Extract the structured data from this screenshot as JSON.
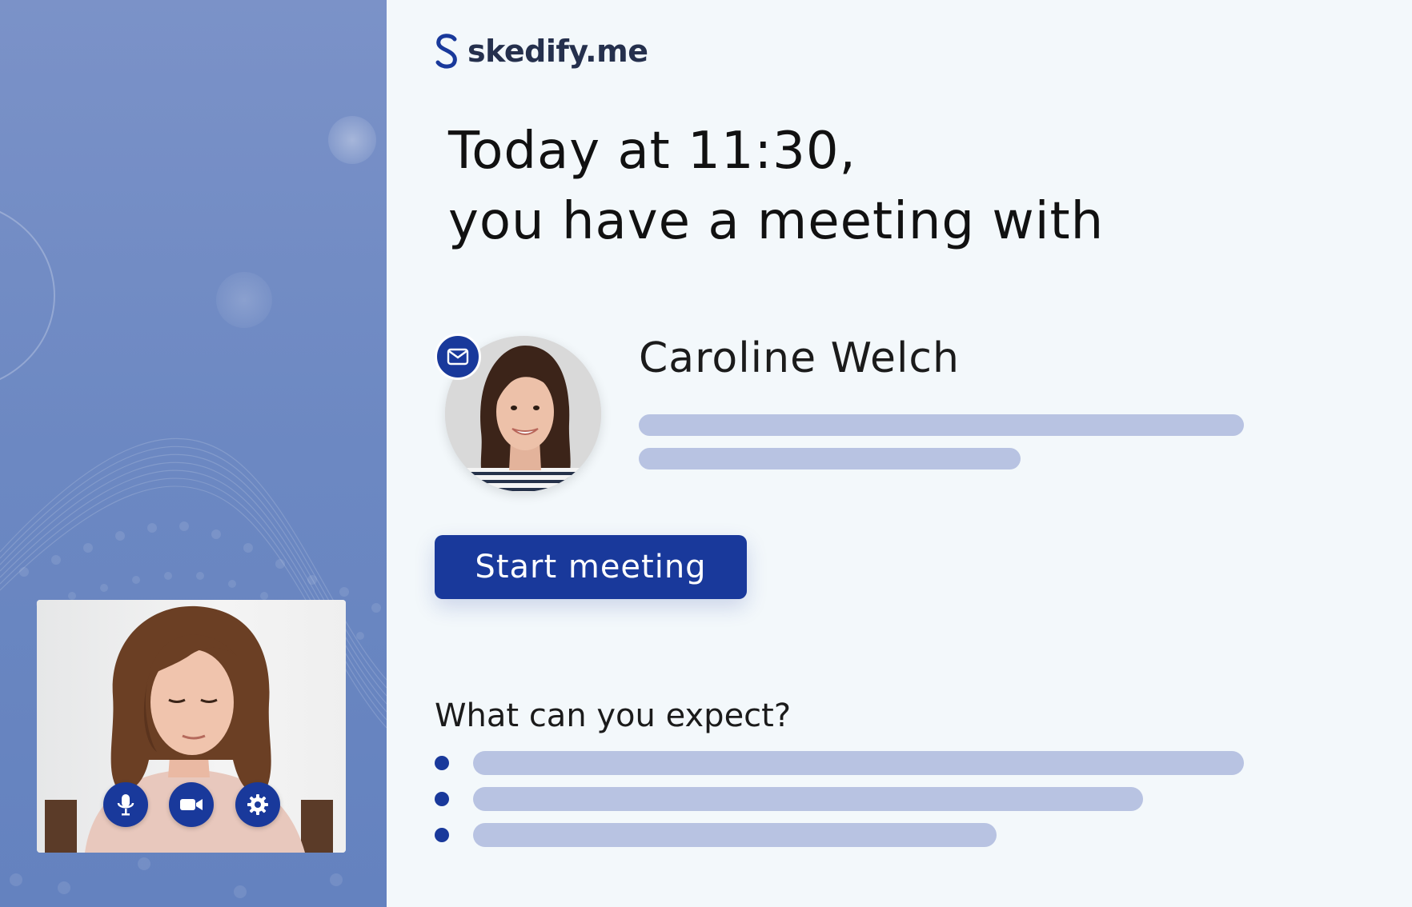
{
  "brand": {
    "logo_text": "skedify.me",
    "accent_color": "#19399b",
    "placeholder_color": "#b8c3e2",
    "left_panel_color": "#6f8ac4"
  },
  "meeting": {
    "headline_line1": "Today at 11:30,",
    "headline_line2": "you have a meeting with",
    "contact_name": "Caroline Welch",
    "start_button_label": "Start meeting"
  },
  "expectations": {
    "heading": "What can you expect?",
    "items": 3
  },
  "video_controls": {
    "icons": [
      "microphone-icon",
      "camera-icon",
      "gear-icon"
    ]
  },
  "avatar_badge_icon": "envelope-icon"
}
